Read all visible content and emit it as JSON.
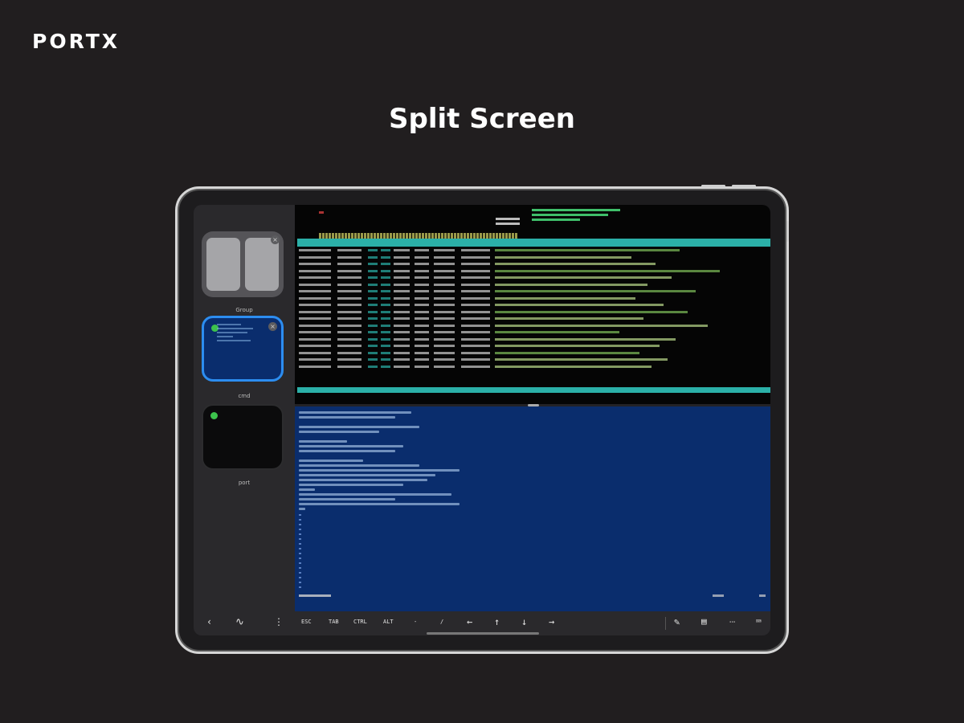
{
  "brand": {
    "logo_text": "PORTX"
  },
  "headline": "Split Screen",
  "sidebar": {
    "cards": [
      {
        "label": "Group"
      },
      {
        "label": "cmd"
      },
      {
        "label": "port"
      }
    ]
  },
  "toolbar": {
    "keys": [
      "ESC",
      "TAB",
      "CTRL",
      "ALT",
      "-",
      "/"
    ],
    "left_icon": "chevron-left-icon",
    "menu_icon": "more-vertical-icon",
    "arrows": [
      "arrow-left-icon",
      "arrow-up-icon",
      "arrow-down-icon",
      "arrow-right-icon"
    ],
    "right_icons": [
      "pen-icon",
      "snippet-icon",
      "ellipsis-icon",
      "keyboard-icon"
    ]
  },
  "colors": {
    "background": "#211e1f",
    "htop_accent": "#2bb0a8",
    "vim_background": "#0a2d6d",
    "selected_border": "#2c8df0",
    "status_dot": "#3cc34c"
  }
}
